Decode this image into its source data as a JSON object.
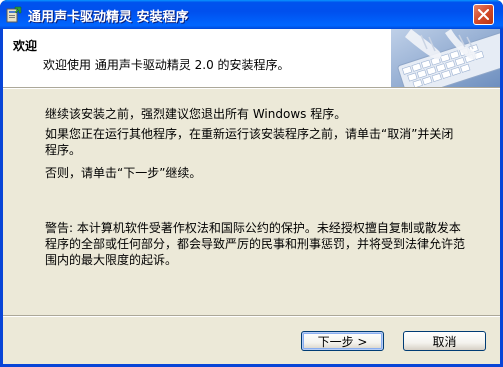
{
  "window": {
    "title": "通用声卡驱动精灵 安装程序"
  },
  "header": {
    "title": "欢迎",
    "subtitle": "欢迎使用 通用声卡驱动精灵 2.0 的安装程序。"
  },
  "body": {
    "paragraph1": "继续该安装之前，强烈建议您退出所有 Windows 程序。",
    "paragraph2": "如果您正在运行其他程序，在重新运行该安装程序之前，请单击“取消”并关闭程序。",
    "paragraph3": "否则，请单击“下一步”继续。",
    "warning": "警告: 本计算机软件受著作权法和国际公约的保护。未经授权擅自复制或散发本程序的全部或任何部分，都会导致严厉的民事和刑事惩罚，并将受到法律允许范围内的最大限度的起诉。"
  },
  "buttons": {
    "next_label": "下一步 >",
    "cancel_label": "取消"
  },
  "icons": {
    "app": "installer-app-icon",
    "close": "close-icon"
  }
}
